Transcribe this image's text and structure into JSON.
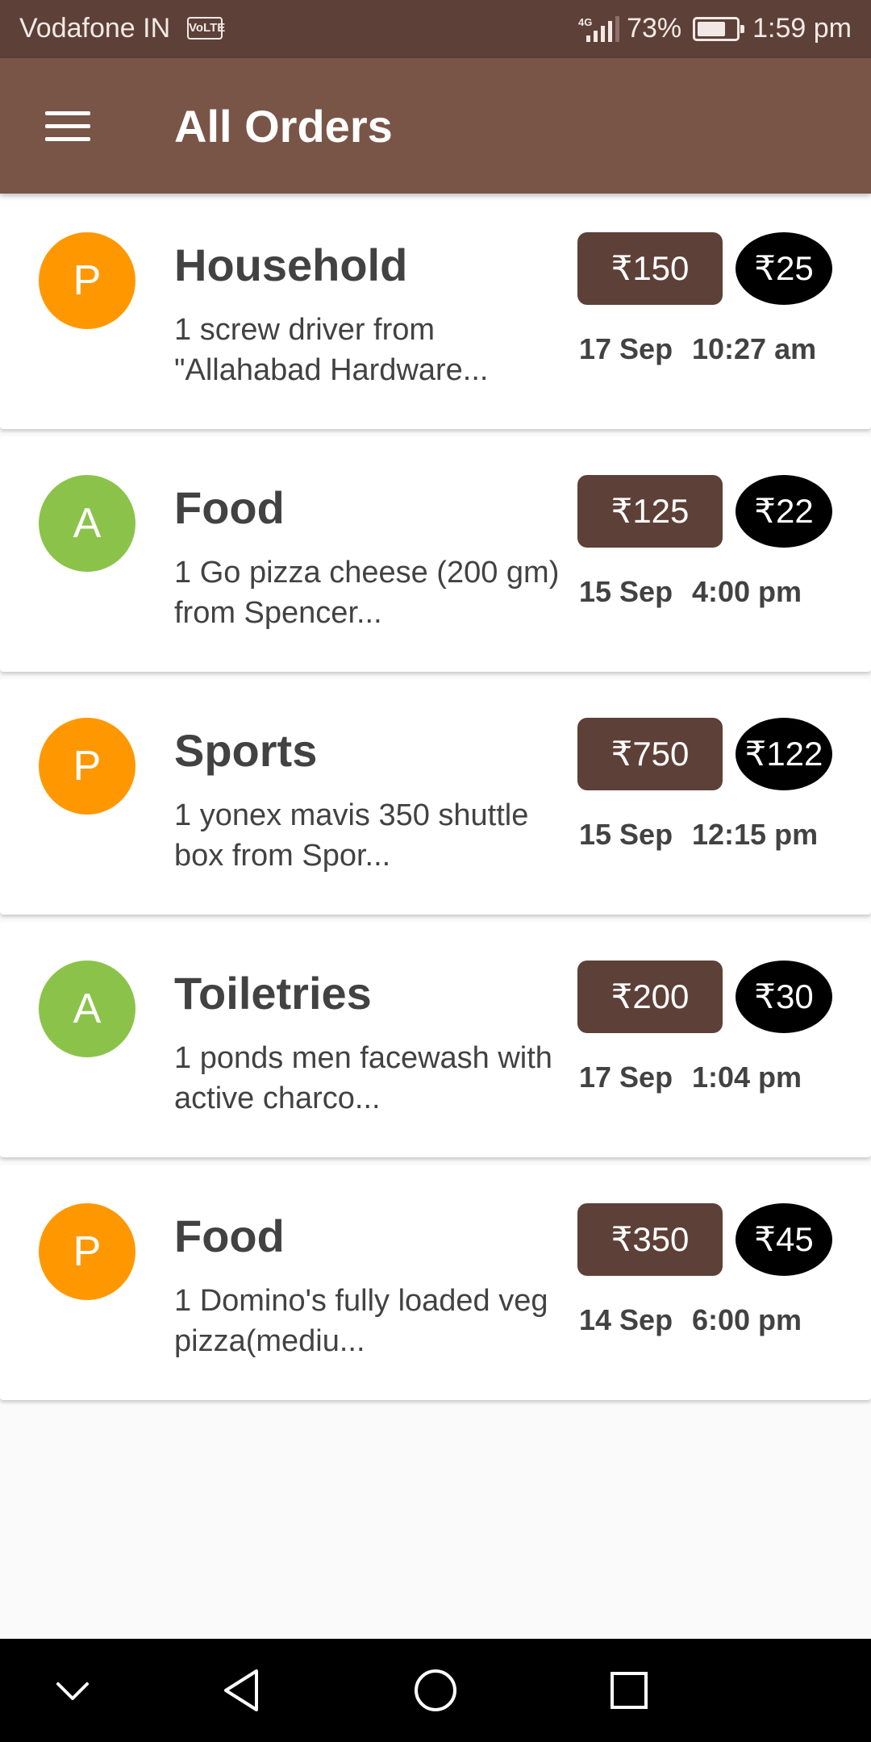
{
  "status_bar": {
    "carrier": "Vodafone IN",
    "volte_badge": "VoLTE",
    "network": "4G",
    "battery": "73%",
    "battery_level": 0.73,
    "time": "1:59 pm"
  },
  "app_bar": {
    "title": "All Orders",
    "menu_icon": "hamburger-menu-icon"
  },
  "orders": [
    {
      "avatar": "P",
      "avatar_color": "#ff9800",
      "category": "Household",
      "description": "1 screw driver from \"Allahabad Hardware...",
      "price": "₹150",
      "fee": "₹25",
      "date": "17 Sep",
      "time": "10:27 am"
    },
    {
      "avatar": "A",
      "avatar_color": "#8bc34a",
      "category": "Food",
      "description": "1 Go pizza cheese (200 gm) from Spencer...",
      "price": "₹125",
      "fee": "₹22",
      "date": "15 Sep",
      "time": "4:00 pm"
    },
    {
      "avatar": "P",
      "avatar_color": "#ff9800",
      "category": "Sports",
      "description": "1 yonex mavis 350 shuttle box from Spor...",
      "price": "₹750",
      "fee": "₹122",
      "date": "15 Sep",
      "time": "12:15 pm"
    },
    {
      "avatar": "A",
      "avatar_color": "#8bc34a",
      "category": "Toiletries",
      "description": "1 ponds men facewash with active charco...",
      "price": "₹200",
      "fee": "₹30",
      "date": "17 Sep",
      "time": "1:04 pm"
    },
    {
      "avatar": "P",
      "avatar_color": "#ff9800",
      "category": "Food",
      "description": "1 Domino's fully loaded veg pizza(mediu...",
      "price": "₹350",
      "fee": "₹45",
      "date": "14 Sep",
      "time": "6:00 pm"
    }
  ],
  "nav_bar": {
    "buttons": [
      "chevron-down-icon",
      "back-triangle-icon",
      "home-circle-icon",
      "recents-square-icon"
    ]
  },
  "colors": {
    "status_bar": "#5d4037",
    "app_bar": "#795548",
    "price_chip": "#5d4037",
    "fee_chip": "#000000",
    "background": "#fafafa"
  }
}
